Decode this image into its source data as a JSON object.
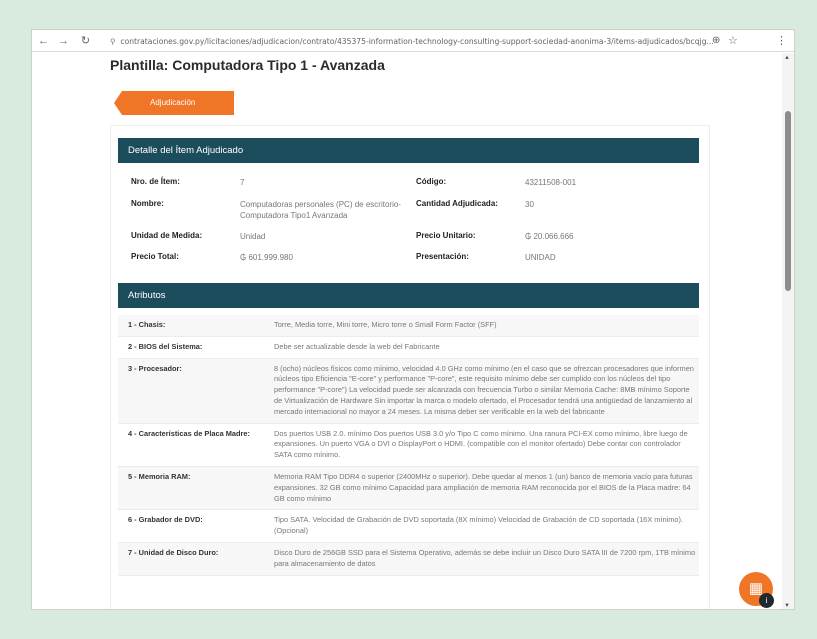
{
  "browser": {
    "url": "contrataciones.gov.py/licitaciones/adjudicacion/contrato/435375-information-technology-consulting-support-sociedad-anonima-3/items-adjudicados/bcqjg..."
  },
  "page": {
    "title": "Plantilla: Computadora Tipo 1 - Avanzada",
    "tab_label": "Adjudicación"
  },
  "detail": {
    "header": "Detalle del Ítem Adjudicado",
    "fields": [
      {
        "label": "Nro. de Ítem:",
        "value": "7"
      },
      {
        "label": "Código:",
        "value": "43211508-001"
      },
      {
        "label": "Nombre:",
        "value": "Computadoras personales (PC) de escritorio-Computadora Tipo1 Avanzada"
      },
      {
        "label": "Cantidad Adjudicada:",
        "value": "30"
      },
      {
        "label": "Unidad de Medida:",
        "value": "Unidad"
      },
      {
        "label": "Precio Unitario:",
        "value": "₲ 20.066.666"
      },
      {
        "label": "Precio Total:",
        "value": "₲ 601.999.980"
      },
      {
        "label": "Presentación:",
        "value": "UNIDAD"
      }
    ]
  },
  "attributes": {
    "header": "Atributos",
    "rows": [
      {
        "name": "1 - Chasis:",
        "value": "Torre, Media torre, Mini torre, Micro torre o Small Form Factor (SFF)"
      },
      {
        "name": "2 - BIOS del Sistema:",
        "value": "Debe ser actualizable desde la web del Fabricante"
      },
      {
        "name": "3 - Procesador:",
        "value": "8 (ocho) núcleos físicos como mínimo, velocidad 4.0 GHz como mínimo (en el caso que se ofrezcan procesadores que informen núcleos tipo Eficiencia \"E-core\" y performance \"P-core\", este requisito mínimo debe ser cumplido con los núcleos del tipo performance \"P-core\") La velocidad puede ser alcanzada con frecuencia Turbo o similar Memoria Cache: 8MB mínimo Soporte de Virtualización de Hardware Sin importar la marca o modelo ofertado, el Procesador tendrá una antigüedad de lanzamiento al mercado internacional no mayor a 24 meses. La misma deber ser verificable en la web del fabricante"
      },
      {
        "name": "4 - Características de Placa Madre:",
        "value": "Dos puertos USB 2.0. mínimo Dos puertos USB 3.0 y/o Tipo C como mínimo. Una ranura PCI-EX como mínimo, libre luego de expansiones. Un puerto VGA o DVI o DisplayPort o HDMI. (compatible con el monitor ofertado) Debe contar con controlador SATA como mínimo."
      },
      {
        "name": "5 - Memoria RAM:",
        "value": "Memoria RAM Tipo DDR4 o superior (2400MHz o superior). Debe quedar al menos 1 (un) banco de memoria vacío para futuras expansiones. 32 GB como mínimo Capacidad para ampliación de memoria RAM reconocida por el BIOS de la Placa madre: 64 GB como mínimo"
      },
      {
        "name": "6 - Grabador de DVD:",
        "value": "Tipo SATA. Velocidad de Grabación de DVD soportada (8X mínimo) Velocidad de Grabación de CD soportada (16X mínimo). (Opcional)"
      },
      {
        "name": "7 - Unidad de Disco Duro:",
        "value": "Disco Duro de 256GB SSD para el Sistema Operativo, además se debe incluir un Disco Duro SATA III de 7200 rpm, 1TB mínimo para almacenamiento de datos"
      }
    ]
  }
}
